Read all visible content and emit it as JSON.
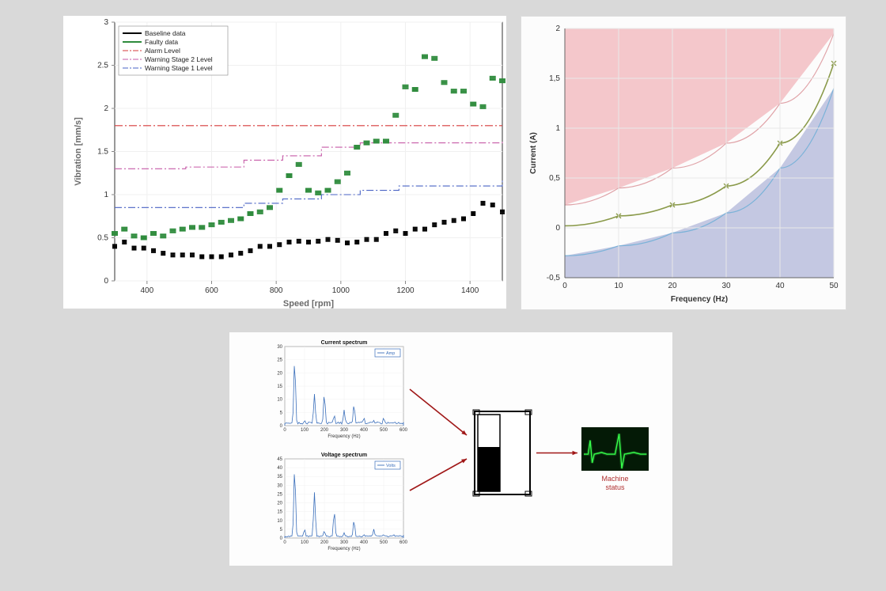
{
  "chart_data": [
    {
      "id": "vibration",
      "type": "scatter",
      "title": "",
      "xlabel": "Speed [rpm]",
      "ylabel": "Vibration [mm/s]",
      "xlim": [
        300,
        1500
      ],
      "ylim": [
        0,
        3
      ],
      "xticks": [
        400,
        600,
        800,
        1000,
        1200,
        1400
      ],
      "yticks": [
        0,
        0.5,
        1,
        1.5,
        2,
        2.5,
        3
      ],
      "legend": [
        "Baseline data",
        "Faulty data",
        "Alarm Level",
        "Warning Stage 2 Level",
        "Warning Stage 1 Level"
      ],
      "colors": {
        "baseline": "#000",
        "faulty": "#2e8b3c",
        "alarm": "#d63a3a",
        "warn2": "#c65aa7",
        "warn1": "#4a63c4"
      },
      "alarm_level": 1.8,
      "warn2_steps": [
        [
          300,
          1.3
        ],
        [
          520,
          1.32
        ],
        [
          700,
          1.4
        ],
        [
          820,
          1.45
        ],
        [
          940,
          1.55
        ],
        [
          1060,
          1.6
        ],
        [
          1500,
          1.62
        ]
      ],
      "warn1_steps": [
        [
          300,
          0.85
        ],
        [
          520,
          0.85
        ],
        [
          700,
          0.9
        ],
        [
          820,
          0.95
        ],
        [
          940,
          1.0
        ],
        [
          1060,
          1.05
        ],
        [
          1180,
          1.1
        ],
        [
          1500,
          1.18
        ]
      ],
      "baseline": [
        [
          300,
          0.4
        ],
        [
          330,
          0.45
        ],
        [
          360,
          0.38
        ],
        [
          390,
          0.38
        ],
        [
          420,
          0.35
        ],
        [
          450,
          0.32
        ],
        [
          480,
          0.3
        ],
        [
          510,
          0.3
        ],
        [
          540,
          0.3
        ],
        [
          570,
          0.28
        ],
        [
          600,
          0.28
        ],
        [
          630,
          0.28
        ],
        [
          660,
          0.3
        ],
        [
          690,
          0.32
        ],
        [
          720,
          0.35
        ],
        [
          750,
          0.4
        ],
        [
          780,
          0.4
        ],
        [
          810,
          0.42
        ],
        [
          840,
          0.45
        ],
        [
          870,
          0.46
        ],
        [
          900,
          0.45
        ],
        [
          930,
          0.46
        ],
        [
          960,
          0.48
        ],
        [
          990,
          0.47
        ],
        [
          1020,
          0.44
        ],
        [
          1050,
          0.45
        ],
        [
          1080,
          0.48
        ],
        [
          1110,
          0.48
        ],
        [
          1140,
          0.55
        ],
        [
          1170,
          0.58
        ],
        [
          1200,
          0.55
        ],
        [
          1230,
          0.6
        ],
        [
          1260,
          0.6
        ],
        [
          1290,
          0.65
        ],
        [
          1320,
          0.68
        ],
        [
          1350,
          0.7
        ],
        [
          1380,
          0.72
        ],
        [
          1410,
          0.78
        ],
        [
          1440,
          0.9
        ],
        [
          1470,
          0.88
        ],
        [
          1500,
          0.8
        ]
      ],
      "faulty": [
        [
          300,
          0.55
        ],
        [
          330,
          0.6
        ],
        [
          360,
          0.52
        ],
        [
          390,
          0.5
        ],
        [
          420,
          0.55
        ],
        [
          450,
          0.52
        ],
        [
          480,
          0.58
        ],
        [
          510,
          0.6
        ],
        [
          540,
          0.62
        ],
        [
          570,
          0.62
        ],
        [
          600,
          0.65
        ],
        [
          630,
          0.68
        ],
        [
          660,
          0.7
        ],
        [
          690,
          0.72
        ],
        [
          720,
          0.78
        ],
        [
          750,
          0.8
        ],
        [
          780,
          0.85
        ],
        [
          810,
          1.05
        ],
        [
          840,
          1.22
        ],
        [
          870,
          1.35
        ],
        [
          900,
          1.05
        ],
        [
          930,
          1.02
        ],
        [
          960,
          1.05
        ],
        [
          990,
          1.15
        ],
        [
          1020,
          1.25
        ],
        [
          1050,
          1.55
        ],
        [
          1080,
          1.6
        ],
        [
          1110,
          1.62
        ],
        [
          1140,
          1.62
        ],
        [
          1170,
          1.92
        ],
        [
          1200,
          2.25
        ],
        [
          1230,
          2.22
        ],
        [
          1260,
          2.6
        ],
        [
          1290,
          2.58
        ],
        [
          1320,
          2.3
        ],
        [
          1350,
          2.2
        ],
        [
          1380,
          2.2
        ],
        [
          1410,
          2.05
        ],
        [
          1440,
          2.02
        ],
        [
          1470,
          2.35
        ],
        [
          1500,
          2.32
        ]
      ]
    },
    {
      "id": "current_band",
      "type": "area",
      "xlabel": "Frequency (Hz)",
      "ylabel": "Current (A)",
      "xlim": [
        0,
        50
      ],
      "ylim": [
        -0.5,
        2
      ],
      "xticks": [
        0,
        10,
        20,
        30,
        40,
        50
      ],
      "yticks": [
        -0.5,
        0,
        0.5,
        1,
        1.5,
        2
      ],
      "upper": [
        [
          0,
          0.23
        ],
        [
          10,
          0.4
        ],
        [
          20,
          0.6
        ],
        [
          30,
          0.85
        ],
        [
          40,
          1.25
        ],
        [
          50,
          1.95
        ]
      ],
      "mid": [
        [
          0,
          0.02
        ],
        [
          10,
          0.12
        ],
        [
          20,
          0.23
        ],
        [
          30,
          0.42
        ],
        [
          40,
          0.85
        ],
        [
          50,
          1.65
        ]
      ],
      "lower": [
        [
          0,
          -0.28
        ],
        [
          10,
          -0.18
        ],
        [
          20,
          -0.05
        ],
        [
          30,
          0.15
        ],
        [
          40,
          0.6
        ],
        [
          50,
          1.4
        ]
      ],
      "mid_markers_x": [
        10,
        20,
        30,
        40,
        50
      ],
      "colors": {
        "upperFill": "#f4c7cb",
        "lowerFill": "#c4c8e2",
        "mid": "#8a9a4a",
        "upperLine": "#e0a3a8",
        "lowerLine": "#7ab2d8"
      }
    },
    {
      "id": "current_spectrum",
      "type": "line",
      "title": "Current spectrum",
      "xlabel": "Frequency (Hz)",
      "ylabel": "",
      "legend": "Amp",
      "xlim": [
        0,
        600
      ],
      "ylim": [
        0,
        30
      ],
      "xticks": [
        0,
        100,
        200,
        300,
        400,
        500,
        600
      ],
      "yticks": [
        0,
        5,
        10,
        15,
        20,
        25,
        30
      ],
      "peaks": [
        [
          50,
          25
        ],
        [
          100,
          2
        ],
        [
          150,
          12
        ],
        [
          200,
          12
        ],
        [
          250,
          4
        ],
        [
          300,
          6
        ],
        [
          350,
          8
        ],
        [
          400,
          3
        ],
        [
          450,
          2
        ],
        [
          500,
          3
        ],
        [
          550,
          1
        ]
      ]
    },
    {
      "id": "voltage_spectrum",
      "type": "line",
      "title": "Voltage spectrum",
      "xlabel": "Frequency (Hz)",
      "ylabel": "",
      "legend": "Volts",
      "xlim": [
        0,
        600
      ],
      "ylim": [
        0,
        45
      ],
      "xticks": [
        0,
        100,
        200,
        300,
        400,
        500,
        600
      ],
      "yticks": [
        0,
        5,
        10,
        15,
        20,
        25,
        30,
        35,
        40,
        45
      ],
      "peaks": [
        [
          50,
          40
        ],
        [
          100,
          5
        ],
        [
          150,
          26
        ],
        [
          200,
          4
        ],
        [
          250,
          15
        ],
        [
          300,
          3
        ],
        [
          350,
          10
        ],
        [
          400,
          2
        ],
        [
          450,
          5
        ],
        [
          500,
          2
        ],
        [
          550,
          2
        ]
      ]
    }
  ],
  "labels": {
    "machine_status": "Machine\nstatus"
  }
}
